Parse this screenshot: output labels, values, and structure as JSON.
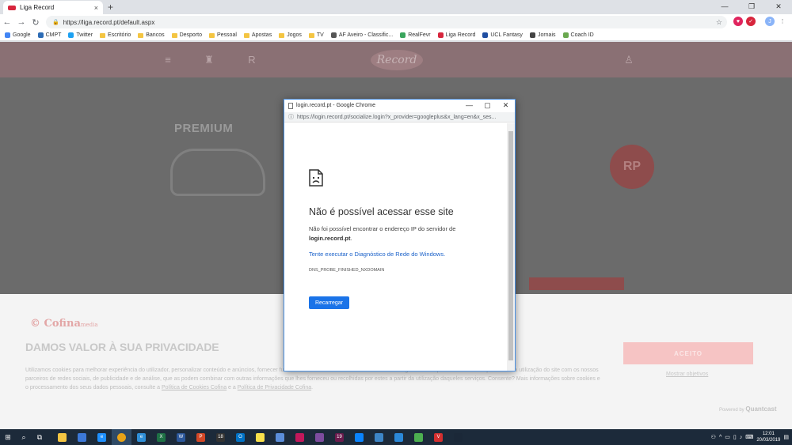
{
  "browser": {
    "tab_title": "Liga Record",
    "tab_close": "×",
    "new_tab": "+",
    "url": "https://liga.record.pt/default.aspx",
    "window_controls": [
      "—",
      "❐",
      "✕"
    ]
  },
  "bookmarks": [
    {
      "label": "Google",
      "type": "site",
      "color": "#4285f4"
    },
    {
      "label": "CMPT",
      "type": "site",
      "color": "#2d6cb5"
    },
    {
      "label": "Twitter",
      "type": "site",
      "color": "#1da1f2"
    },
    {
      "label": "Escritório",
      "type": "folder"
    },
    {
      "label": "Bancos",
      "type": "folder"
    },
    {
      "label": "Desporto",
      "type": "folder"
    },
    {
      "label": "Pessoal",
      "type": "folder"
    },
    {
      "label": "Apostas",
      "type": "folder"
    },
    {
      "label": "Jogos",
      "type": "folder"
    },
    {
      "label": "TV",
      "type": "folder"
    },
    {
      "label": "AF Aveiro - Classific...",
      "type": "site",
      "color": "#555555"
    },
    {
      "label": "RealFevr",
      "type": "site",
      "color": "#3aa55d"
    },
    {
      "label": "Liga Record",
      "type": "site",
      "color": "#d7263d"
    },
    {
      "label": "UCL Fantasy",
      "type": "site",
      "color": "#1f4ea1"
    },
    {
      "label": "Jornais",
      "type": "site",
      "color": "#444444"
    },
    {
      "label": "Coach ID",
      "type": "site",
      "color": "#6aa84f"
    }
  ],
  "page": {
    "logo": "Record",
    "premium": "PREMIUM",
    "badge": "RP"
  },
  "popup": {
    "title": "login.record.pt - Google Chrome",
    "url": "https://login.record.pt/socialize.login?x_provider=googleplus&x_lang=en&x_ses...",
    "error_title": "Não é possível acessar esse site",
    "error_text": "Não foi possível encontrar o endereço IP do servidor de",
    "error_host": "login.record.pt",
    "error_link": "Tente executar o Diagnóstico de Rede do Windows.",
    "error_code": "DNS_PROBE_FINISHED_NXDOMAIN",
    "reload_label": "Recarregar"
  },
  "cookie": {
    "brand": "Cofina",
    "brand_sub": "media",
    "heading": "DAMOS VALOR À SUA PRIVACIDADE",
    "text_1": "Utilizamos cookies para melhorar experiência do utilizador, personalizar conteúdo e anúncios, fornecer funcionalidades das redes sociais e analisar o tráfego. Também partilhamos informações sobre a utilização do site com os nossos parceiros de redes sociais, de publicidade e de análise, que as podem combinar com outras informações que lhes forneceu ou recolhidas por estes a partir da utilização daqueles serviços. Consente? Mais informações sobre cookies e o processamento dos seus dados pessoais, consulte a ",
    "link_cookies": "Política de Cookies Cofina",
    "text_2": " e a ",
    "link_privacy": "Política de Privacidade Cofina",
    "text_3": ".",
    "accept_label": "ACEITO",
    "show_purposes": "Mostrar objetivos",
    "powered": "Powered by",
    "powered_brand": "Quantcast"
  },
  "taskbar": {
    "apps": [
      {
        "name": "file-explorer",
        "color": "#f4c542",
        "glyph": ""
      },
      {
        "name": "network",
        "color": "#3c78d8",
        "glyph": ""
      },
      {
        "name": "edge",
        "color": "#1e90ff",
        "glyph": "e"
      },
      {
        "name": "chrome",
        "color": "#e8a317",
        "glyph": ""
      },
      {
        "name": "ie",
        "color": "#2f8fd8",
        "glyph": "e"
      },
      {
        "name": "excel",
        "color": "#1e7145",
        "glyph": "X"
      },
      {
        "name": "word",
        "color": "#2b579a",
        "glyph": "W"
      },
      {
        "name": "powerpoint",
        "color": "#d24726",
        "glyph": "P"
      },
      {
        "name": "app-18",
        "color": "#333333",
        "glyph": "18"
      },
      {
        "name": "outlook",
        "color": "#0072c6",
        "glyph": "O"
      },
      {
        "name": "sticky-notes",
        "color": "#f9e04b",
        "glyph": ""
      },
      {
        "name": "app-circle",
        "color": "#5b8dd9",
        "glyph": ""
      },
      {
        "name": "maps",
        "color": "#c2185b",
        "glyph": ""
      },
      {
        "name": "app-photo",
        "color": "#7d4c9e",
        "glyph": ""
      },
      {
        "name": "app-19",
        "color": "#6a1b4d",
        "glyph": "19"
      },
      {
        "name": "app-cloud",
        "color": "#0a84ff",
        "glyph": ""
      },
      {
        "name": "app-screen",
        "color": "#3d85c6",
        "glyph": ""
      },
      {
        "name": "store",
        "color": "#2b88d8",
        "glyph": ""
      },
      {
        "name": "app-cup",
        "color": "#4caf50",
        "glyph": ""
      },
      {
        "name": "vivaldi",
        "color": "#d32f2f",
        "glyph": "V"
      },
      {
        "name": "steam",
        "color": "#1b2838",
        "glyph": ""
      }
    ],
    "time": "12:01",
    "date": "20/03/2019"
  },
  "colors": {
    "accent": "#1a73e8",
    "overlay": "#6b6b6b",
    "record_red": "#d7263d"
  }
}
